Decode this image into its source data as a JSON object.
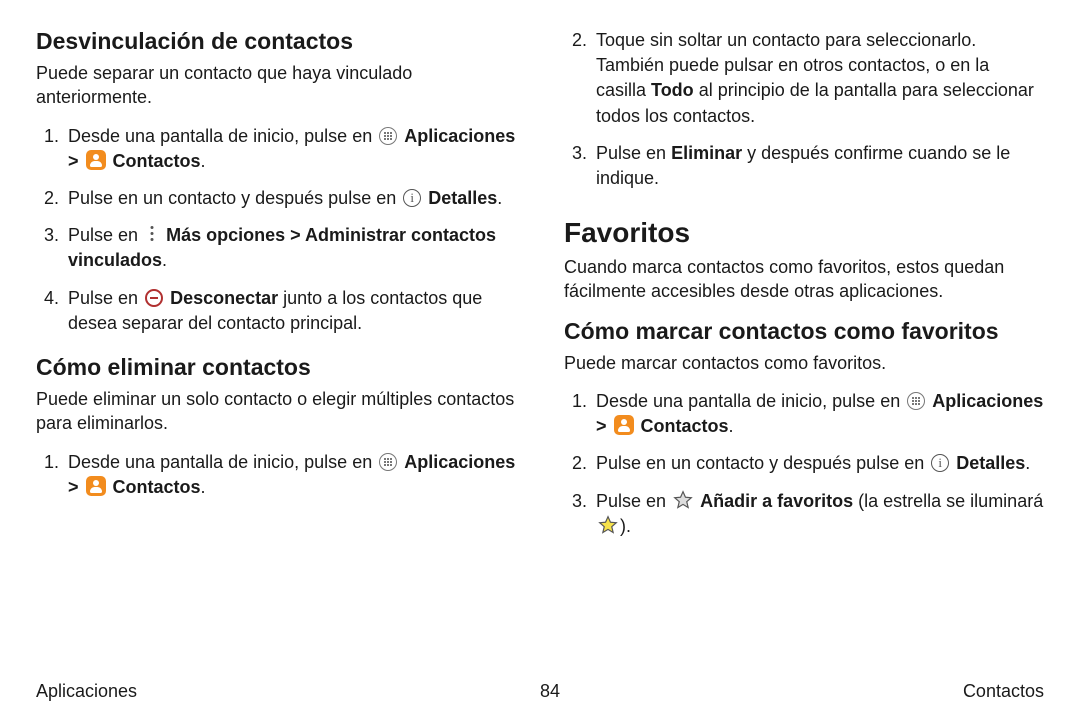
{
  "left": {
    "h1": "Desvinculación de contactos",
    "p1": "Puede separar un contacto que haya vinculado anteriormente.",
    "list1": {
      "i1a": "Desde una pantalla de inicio, pulse en ",
      "apps": "Aplicaciones",
      "sep": " > ",
      "contacts": "Contactos",
      "dot": ".",
      "i2a": "Pulse en un contacto y después pulse en ",
      "details": "Detalles",
      "i3a": "Pulse en ",
      "more": "Más opciones",
      "i3b": " > ",
      "admin": "Administrar contactos vinculados",
      "i4a": "Pulse en ",
      "disconnect": "Desconectar",
      "i4b": " junto a los contactos que desea separar del contacto principal."
    },
    "h2": "Cómo eliminar contactos",
    "p2": "Puede eliminar un solo contacto o elegir múltiples contactos para eliminarlos.",
    "list2": {
      "i1a": "Desde una pantalla de inicio, pulse en "
    }
  },
  "right": {
    "cont": {
      "i2a": "Toque sin soltar un contacto para seleccionarlo. También puede pulsar en otros contactos, o en la casilla ",
      "todo": "Todo",
      "i2b": " al principio de la pantalla para seleccionar todos los contactos.",
      "i3a": "Pulse en ",
      "eliminar": "Eliminar",
      "i3b": " y después confirme cuando se le indique."
    },
    "h1": "Favoritos",
    "p1": "Cuando marca contactos como favoritos, estos quedan fácilmente accesibles desde otras aplicaciones.",
    "h2": "Cómo marcar contactos como favoritos",
    "p2": "Puede marcar contactos como favoritos.",
    "list": {
      "i1a": "Desde una pantalla de inicio, pulse en ",
      "i2a": "Pulse en un contacto y después pulse en ",
      "i3a": "Pulse en ",
      "addfav": "Añadir a favoritos",
      "i3b": " (la estrella se iluminará ",
      "i3c": ")."
    }
  },
  "labels": {
    "apps": "Aplicaciones",
    "contacts": "Contactos",
    "details": "Detalles"
  },
  "footer": {
    "left": "Aplicaciones",
    "center": "84",
    "right": "Contactos"
  }
}
